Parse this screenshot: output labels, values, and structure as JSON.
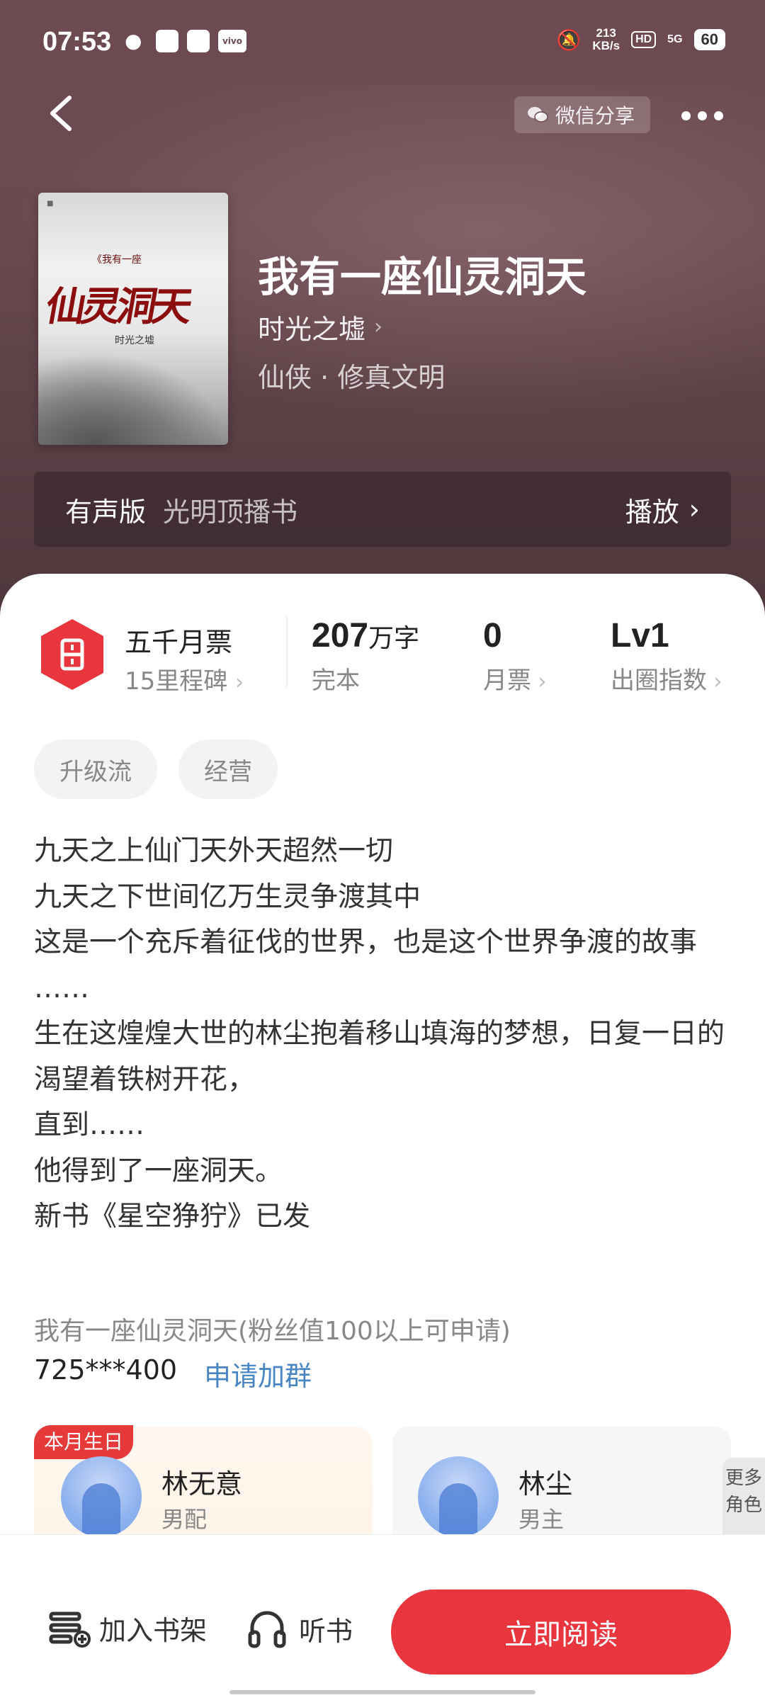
{
  "status_bar": {
    "time": "07:53",
    "net_speed_value": "213",
    "net_speed_unit": "KB/s",
    "hd": "HD",
    "signal": "5G",
    "battery": "60"
  },
  "nav": {
    "share_label": "微信分享"
  },
  "book": {
    "cover": {
      "subtitle": "《我有一座",
      "title": "仙灵洞天",
      "author": "时光之墟"
    },
    "title": "我有一座仙灵洞天",
    "author": "时光之墟",
    "genre": "仙侠 · 修真文明"
  },
  "audio": {
    "label": "有声版",
    "narrator": "光明顶播书",
    "play_label": "播放"
  },
  "stats": {
    "ticket_title": "五千月票",
    "ticket_sub": "15里程碑",
    "words_value": "207",
    "words_unit": "万字",
    "words_label": "完本",
    "monthly_value": "0",
    "monthly_label": "月票",
    "level_value": "Lv1",
    "level_label": "出圈指数"
  },
  "tags": [
    "升级流",
    "经营"
  ],
  "description": [
    "九天之上仙门天外天超然一切",
    "九天之下世间亿万生灵争渡其中",
    "这是一个充斥着征伐的世界，也是这个世界争渡的故事",
    "……",
    "生在这煌煌大世的林尘抱着移山填海的梦想，日复一日的渴望着铁树开花，",
    "直到……",
    "他得到了一座洞天。",
    "新书《星空狰狞》已发"
  ],
  "fan_group": {
    "name": "我有一座仙灵洞天(粉丝值100以上可申请)",
    "id": "725***400",
    "apply_label": "申请加群"
  },
  "characters": [
    {
      "badge": "本月生日",
      "name": "林无意",
      "role": "男配"
    },
    {
      "name": "林尘",
      "role": "男主"
    }
  ],
  "more_roles": "更多角色",
  "bottom_bar": {
    "shelf_label": "加入书架",
    "listen_label": "听书",
    "read_label": "立即阅读"
  },
  "colors": {
    "hero_bg": "#6a4a50",
    "accent_red": "#e8353e",
    "link_blue": "#4a86c5"
  }
}
